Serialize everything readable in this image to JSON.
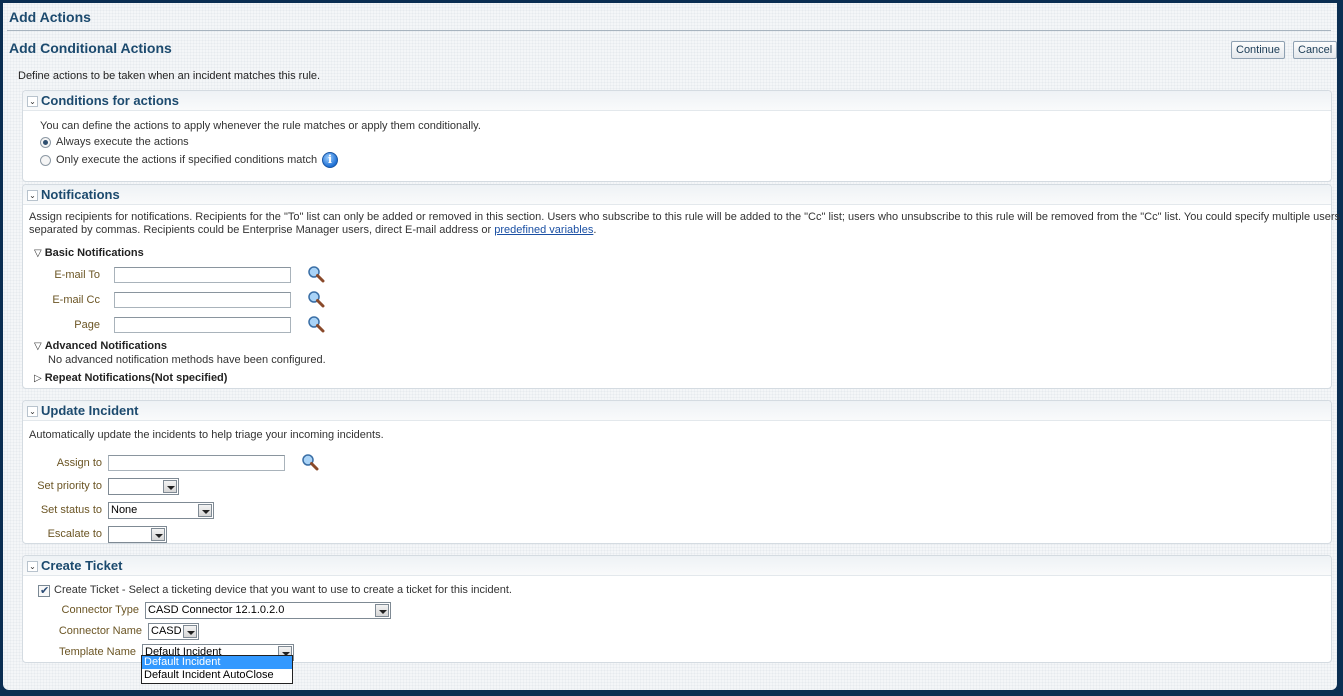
{
  "window": {
    "title": "Add Actions"
  },
  "page": {
    "title": "Add Conditional Actions",
    "intro": "Define actions to be taken when an incident matches this rule.",
    "buttons": {
      "continue": "Continue",
      "cancel": "Cancel"
    }
  },
  "conditions": {
    "title": "Conditions for actions",
    "description": "You can define the actions to apply whenever the rule matches or apply them conditionally.",
    "options": [
      {
        "label": "Always execute the actions",
        "selected": true
      },
      {
        "label": "Only execute the actions if specified conditions match",
        "selected": false
      }
    ],
    "info_icon": "info-icon"
  },
  "notifications": {
    "title": "Notifications",
    "description_line1": "Assign recipients for notifications. Recipients for the \"To\" list can only be added or removed in this section. Users who subscribe to this rule will be added to the \"Cc\" list; users who unsubscribe to this rule will be removed from the \"Cc\" list. You could specify multiple users",
    "description_line2": "separated by commas. Recipients could be Enterprise Manager users, direct E-mail address or ",
    "link_text": "predefined variables",
    "link_suffix": ".",
    "basic": {
      "title": "Basic Notifications",
      "fields": [
        {
          "label": "E-mail To",
          "value": ""
        },
        {
          "label": "E-mail Cc",
          "value": ""
        },
        {
          "label": "Page",
          "value": ""
        }
      ]
    },
    "advanced": {
      "title": "Advanced Notifications",
      "message": "No advanced notification methods have been configured."
    },
    "repeat": {
      "title": "Repeat Notifications(Not specified)"
    }
  },
  "update_incident": {
    "title": "Update Incident",
    "description": "Automatically update the incidents to help triage your incoming incidents.",
    "assign_to": {
      "label": "Assign to",
      "value": ""
    },
    "priority": {
      "label": "Set priority to",
      "value": ""
    },
    "status": {
      "label": "Set status to",
      "value": "None"
    },
    "escalate": {
      "label": "Escalate to",
      "value": ""
    }
  },
  "create_ticket": {
    "title": "Create Ticket",
    "checkbox_label": "Create Ticket - Select a ticketing device that you want to use to create a ticket for this incident.",
    "checked": true,
    "connector_type": {
      "label": "Connector Type",
      "value": "CASD Connector 12.1.0.2.0"
    },
    "connector_name": {
      "label": "Connector Name",
      "value": "CASD"
    },
    "template_name": {
      "label": "Template Name",
      "value": "Default Incident",
      "options": [
        "Default Incident",
        "Default Incident AutoClose"
      ],
      "highlighted": "Default Incident"
    }
  }
}
